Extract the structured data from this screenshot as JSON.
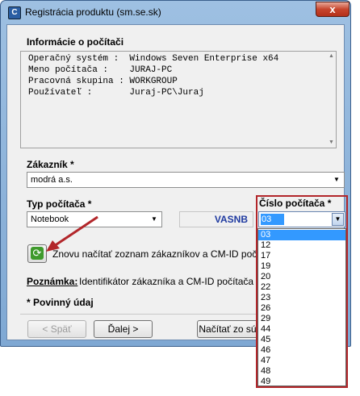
{
  "window": {
    "title": "Registrácia produktu (sm.se.sk)",
    "close_label": "x",
    "app_icon": "C"
  },
  "info": {
    "heading": "Informácie o počítači",
    "lines": [
      "Operačný systém :  Windows Seven Enterprise x64",
      "Meno počítača :    JURAJ-PC",
      "Pracovná skupina : WORKGROUP",
      "Používateľ :       Juraj-PC\\Juraj"
    ]
  },
  "customer": {
    "label": "Zákazník *",
    "value": "modrá a.s."
  },
  "pc_type": {
    "label": "Typ počítača *",
    "value": "Notebook",
    "code": "VASNB"
  },
  "pc_number": {
    "label": "Číslo počítača *",
    "value": "03",
    "options": [
      "03",
      "12",
      "17",
      "19",
      "20",
      "22",
      "23",
      "26",
      "29",
      "44",
      "45",
      "46",
      "47",
      "48",
      "49"
    ],
    "selected_index": 0
  },
  "reload": {
    "text": "Znovu načítať zoznam zákazníkov a CM-ID počítača"
  },
  "note": {
    "label": "Poznámka:",
    "text": "Identifikátor zákazníka a CM-ID počítača môže"
  },
  "required_note": "* Povinný údaj",
  "buttons": {
    "back": "< Späť",
    "next": "Ďalej >",
    "load": "Načítať zo sú"
  },
  "colors": {
    "highlight": "#b2262a",
    "selection": "#3399ff",
    "code_text": "#1f3aa0"
  }
}
